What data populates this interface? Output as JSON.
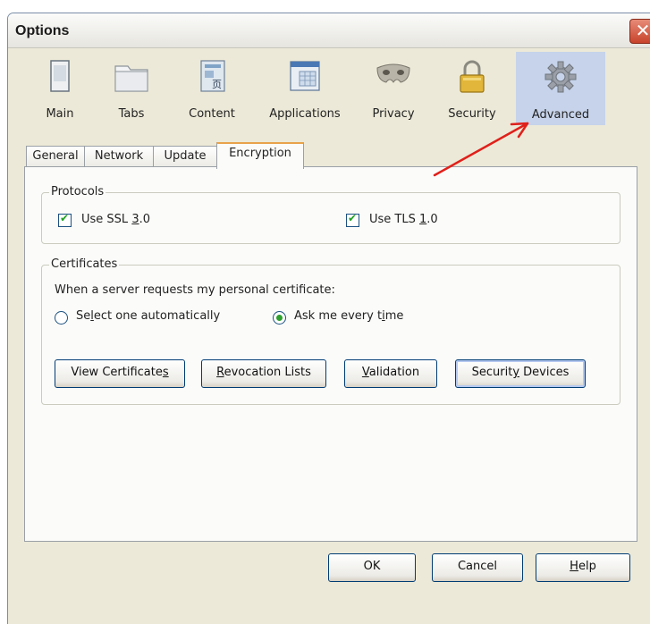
{
  "window": {
    "title": "Options"
  },
  "toolbar": {
    "items": [
      {
        "label": "Main",
        "icon": "main-window-icon"
      },
      {
        "label": "Tabs",
        "icon": "tabs-folder-icon"
      },
      {
        "label": "Content",
        "icon": "content-page-icon"
      },
      {
        "label": "Applications",
        "icon": "applications-icon"
      },
      {
        "label": "Privacy",
        "icon": "privacy-mask-icon"
      },
      {
        "label": "Security",
        "icon": "security-lock-icon"
      },
      {
        "label": "Advanced",
        "icon": "advanced-gear-icon",
        "selected": true
      }
    ]
  },
  "tabs": [
    "General",
    "Network",
    "Update",
    "Encryption"
  ],
  "active_tab": "Encryption",
  "protocols": {
    "legend": "Protocols",
    "ssl": {
      "pre": "Use SSL ",
      "key": "3",
      "post": ".0",
      "checked": true
    },
    "tls": {
      "pre": "Use TLS ",
      "key": "1",
      "post": ".0",
      "checked": true
    }
  },
  "certificates": {
    "legend": "Certificates",
    "prompt": "When a server requests my personal certificate:",
    "option_auto": {
      "pre": "Se",
      "key": "l",
      "post": "ect one automatically",
      "selected": false
    },
    "option_ask": {
      "pre": "Ask me every t",
      "key": "i",
      "post": "me",
      "selected": true
    },
    "buttons": {
      "view": {
        "pre": "View Certificate",
        "key": "s",
        "post": ""
      },
      "revocation": {
        "pre": "",
        "key": "R",
        "post": "evocation Lists"
      },
      "validation": {
        "pre": "",
        "key": "V",
        "post": "alidation"
      },
      "devices": {
        "pre": "Securit",
        "key": "y",
        "post": " Devices"
      }
    }
  },
  "footer": {
    "ok": "OK",
    "cancel": "Cancel",
    "help": {
      "pre": "",
      "key": "H",
      "post": "elp"
    }
  },
  "colors": {
    "selected_toolbar_bg": "#c6d3ea",
    "annotation_arrow": "#e0201a",
    "tab_accent": "#e8a24a"
  }
}
